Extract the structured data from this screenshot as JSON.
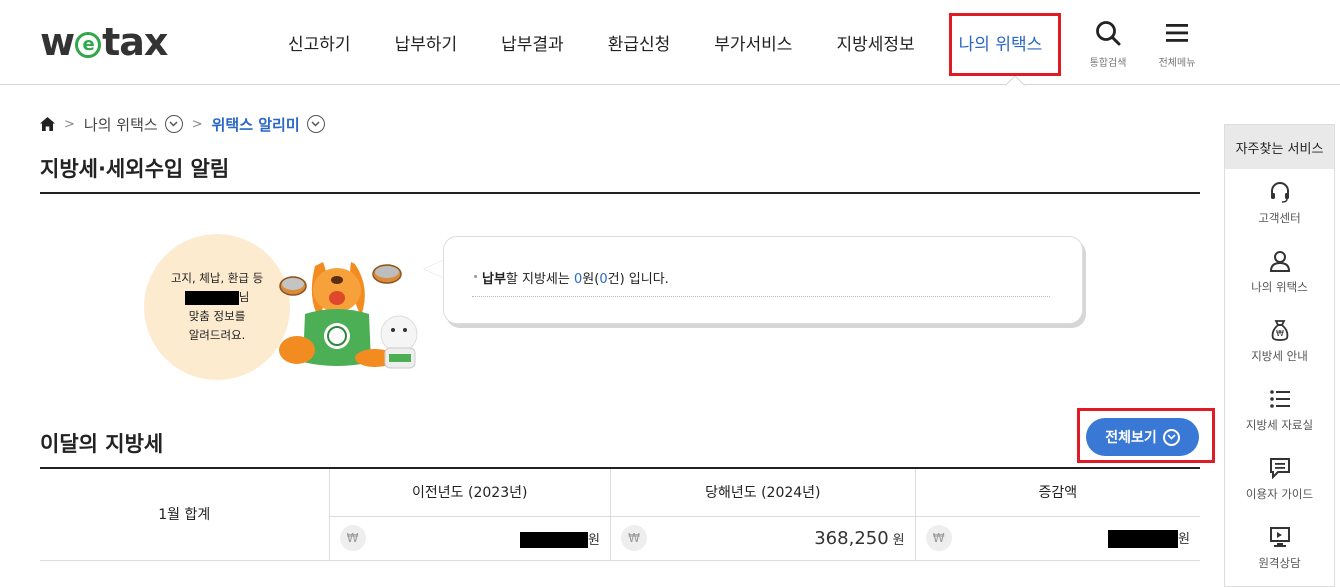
{
  "header": {
    "logo": {
      "pre": "w",
      "e": "e",
      "post": "tax"
    },
    "nav": [
      "신고하기",
      "납부하기",
      "납부결과",
      "환급신청",
      "부가서비스",
      "지방세정보",
      "나의 위택스"
    ],
    "search_label": "통합검색",
    "menu_label": "전체메뉴"
  },
  "breadcrumb": {
    "level1": "나의 위택스",
    "level2": "위택스 알리미"
  },
  "page_title": "지방세·세외수입 알림",
  "notice": {
    "circle_lines": [
      "고지, 체납, 환급 등",
      "님",
      "맞춤 정보를",
      "알려드려요."
    ],
    "bubble": {
      "bold": "납부",
      "pre": "할 지방세는 ",
      "amount": "0",
      "won": "원(",
      "count": "0",
      "suffix": "건) 입니다."
    }
  },
  "monthly": {
    "title": "이달의 지방세",
    "view_all": "전체보기",
    "headers": [
      "이전년도 (2023년)",
      "당해년도 (2024년)",
      "증감액"
    ],
    "row_label": "1월 합계",
    "won_symbol": "₩",
    "unit": "원",
    "current_amount": "368,250"
  },
  "quick": {
    "title": "자주찾는 서비스",
    "items": [
      "고객센터",
      "나의 위택스",
      "지방세 안내",
      "지방세 자료실",
      "이용자 가이드",
      "원격상담"
    ]
  },
  "colors": {
    "accent": "#2a67c7",
    "button": "#3a78d6",
    "highlight": "#e11b24",
    "brand_green": "#2ea84a"
  }
}
